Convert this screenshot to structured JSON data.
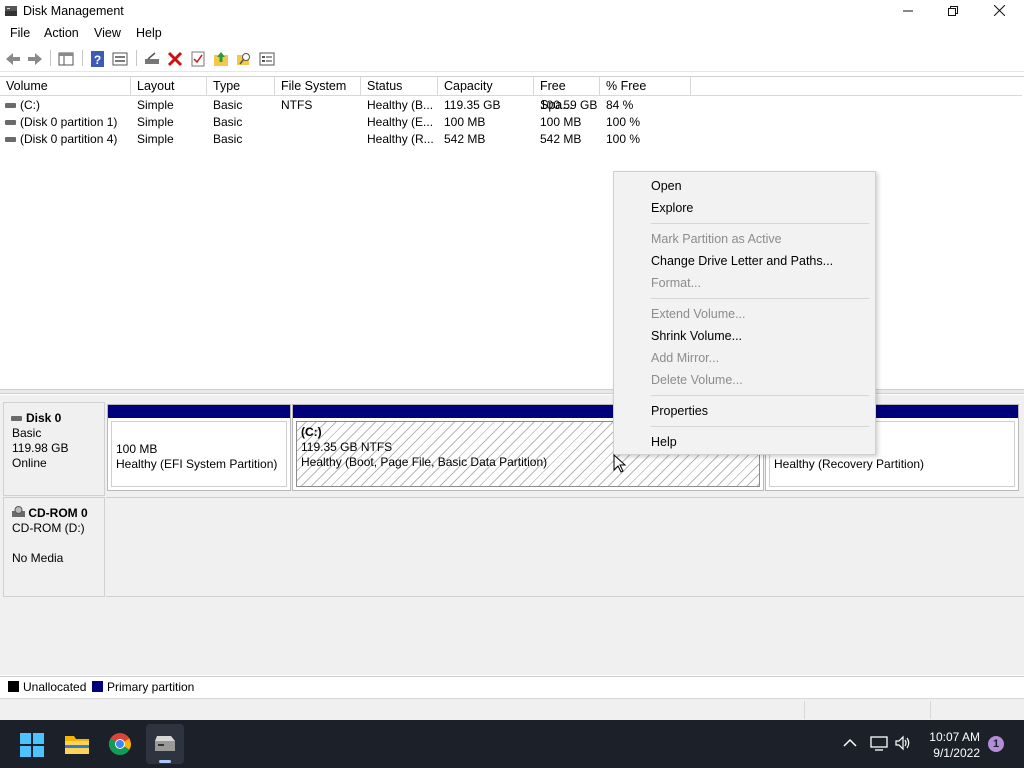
{
  "window": {
    "title": "Disk Management"
  },
  "menu": [
    "File",
    "Action",
    "View",
    "Help"
  ],
  "table": {
    "columns": [
      "Volume",
      "Layout",
      "Type",
      "File System",
      "Status",
      "Capacity",
      "Free Spa...",
      "% Free"
    ],
    "rows": [
      [
        "(C:)",
        "Simple",
        "Basic",
        "NTFS",
        "Healthy (B...",
        "119.35 GB",
        "100.59 GB",
        "84 %"
      ],
      [
        "(Disk 0 partition 1)",
        "Simple",
        "Basic",
        "",
        "Healthy (E...",
        "100 MB",
        "100 MB",
        "100 %"
      ],
      [
        "(Disk 0 partition 4)",
        "Simple",
        "Basic",
        "",
        "Healthy (R...",
        "542 MB",
        "542 MB",
        "100 %"
      ]
    ]
  },
  "disks": [
    {
      "name": "Disk 0",
      "type": "Basic",
      "size": "119.98 GB",
      "status": "Online",
      "partitions": [
        {
          "title": "",
          "line1": "100 MB",
          "line2": "Healthy (EFI System Partition)"
        },
        {
          "title": "(C:)",
          "line1": "119.35 GB NTFS",
          "line2": "Healthy (Boot, Page File, Basic Data Partition)"
        },
        {
          "title": "",
          "line1": "",
          "line2": "Healthy (Recovery Partition)"
        }
      ]
    },
    {
      "name": "CD-ROM 0",
      "type": "CD-ROM (D:)",
      "size": "",
      "status": "No Media"
    }
  ],
  "legend": [
    {
      "label": "Unallocated",
      "color": "#000000"
    },
    {
      "label": "Primary partition",
      "color": "#00007a"
    }
  ],
  "context_menu": {
    "items": [
      {
        "label": "Open",
        "enabled": true
      },
      {
        "label": "Explore",
        "enabled": true
      },
      {
        "label": "Mark Partition as Active",
        "enabled": false
      },
      {
        "label": "Change Drive Letter and Paths...",
        "enabled": true
      },
      {
        "label": "Format...",
        "enabled": false
      },
      {
        "label": "Extend Volume...",
        "enabled": false
      },
      {
        "label": "Shrink Volume...",
        "enabled": true
      },
      {
        "label": "Add Mirror...",
        "enabled": false
      },
      {
        "label": "Delete Volume...",
        "enabled": false
      },
      {
        "label": "Properties",
        "enabled": true
      },
      {
        "label": "Help",
        "enabled": true
      }
    ]
  },
  "taskbar": {
    "time": "10:07 AM",
    "date": "9/1/2022",
    "notification_count": "1",
    "apps": [
      "start-icon",
      "file-explorer-icon",
      "chrome-icon",
      "disk-management-icon"
    ]
  },
  "colors": {
    "primary_partition": "#00007a",
    "taskbar": "#1c2028",
    "notification_badge": "#b48cd8"
  }
}
